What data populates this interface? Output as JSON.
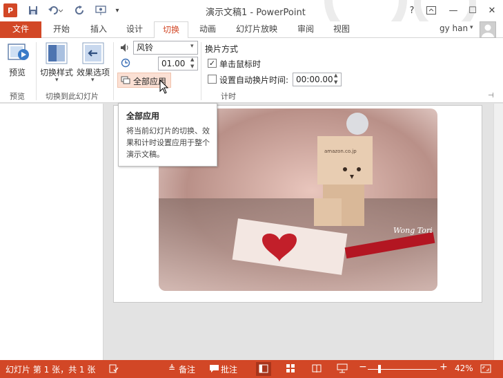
{
  "window": {
    "title": "演示文稿1 - PowerPoint",
    "help": "?",
    "min": "—",
    "max": "☐",
    "close": "✕"
  },
  "qat": {
    "logo": "P"
  },
  "tabs": [
    {
      "label": "文件"
    },
    {
      "label": "开始"
    },
    {
      "label": "插入"
    },
    {
      "label": "设计"
    },
    {
      "label": "切换"
    },
    {
      "label": "动画"
    },
    {
      "label": "幻灯片放映"
    },
    {
      "label": "审阅"
    },
    {
      "label": "视图"
    }
  ],
  "user": {
    "name": "gy han"
  },
  "ribbon": {
    "preview": {
      "label": "预览",
      "group": "预览"
    },
    "switch_style": {
      "label": "切换样式"
    },
    "effect_options": {
      "label": "效果选项"
    },
    "group_transition": "切换到此幻灯片",
    "sound": {
      "value": "风铃"
    },
    "duration": {
      "value": "01.00"
    },
    "apply_all": {
      "label": "全部应用"
    },
    "advance": {
      "title": "换片方式",
      "on_click": "单击鼠标时",
      "on_click_checked": true,
      "auto": "设置自动换片时间:",
      "auto_checked": false,
      "auto_time": "00:00.00"
    },
    "group_timing": "计时"
  },
  "tooltip": {
    "title": "全部应用",
    "body": "将当前幻灯片的切换、效果和计时设置应用于整个演示文稿。"
  },
  "slide": {
    "photo_text": "amazon.co.jp",
    "watermark": "Wong Tori"
  },
  "status": {
    "slide_info": "幻灯片 第 1 张，共 1 张",
    "notes": "备注",
    "comments": "批注",
    "zoom": "42%",
    "zoom_level": 42
  },
  "colors": {
    "accent": "#d24726"
  }
}
